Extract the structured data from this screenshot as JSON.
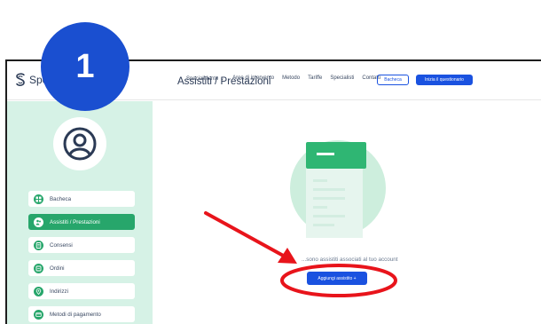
{
  "step_number": "1",
  "navbar": {
    "logo_text": "SpecialMente",
    "links": [
      "SpecialMente ⌄",
      "Aree di intervento",
      "Metodo",
      "Tariffe",
      "Specialisti",
      "Contatti"
    ],
    "bacheca_button": "Bacheca",
    "questionnaire_button": "Inizia il questionario"
  },
  "sidebar": {
    "items": [
      {
        "label": "Bacheca",
        "icon": "dashboard-icon",
        "active": false
      },
      {
        "label": "Assistiti / Prestazioni",
        "icon": "people-icon",
        "active": true
      },
      {
        "label": "Consensi",
        "icon": "document-icon",
        "active": false
      },
      {
        "label": "Ordini",
        "icon": "cart-icon",
        "active": false
      },
      {
        "label": "Indirizzi",
        "icon": "location-icon",
        "active": false
      },
      {
        "label": "Metodi di pagamento",
        "icon": "card-icon",
        "active": false
      }
    ]
  },
  "main": {
    "title": "Assistiti / Prestazioni",
    "empty_text": "...sono assistiti associati al tuo account",
    "add_button": "Aggiungi assistito  +"
  },
  "colors": {
    "primary_blue": "#1a52e0",
    "green": "#27a66b",
    "sidebar_bg": "#d6f2e6",
    "annotation_red": "#e8141b"
  }
}
